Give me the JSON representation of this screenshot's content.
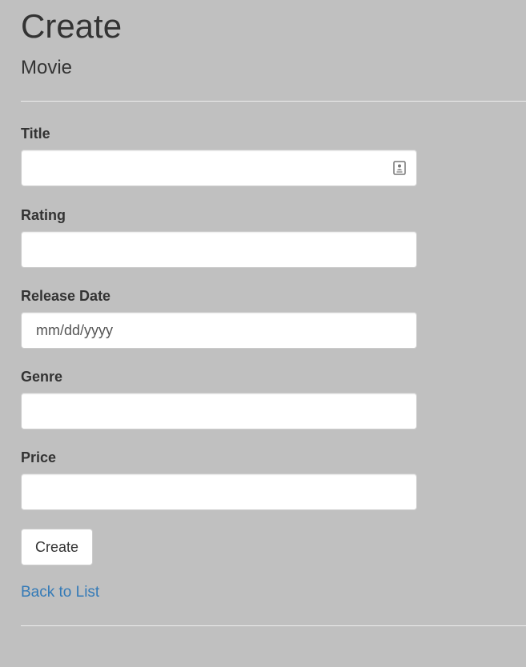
{
  "page": {
    "heading": "Create",
    "subheading": "Movie"
  },
  "form": {
    "fields": [
      {
        "label": "Title",
        "value": "",
        "placeholder": ""
      },
      {
        "label": "Rating",
        "value": "",
        "placeholder": ""
      },
      {
        "label": "Release Date",
        "value": "",
        "placeholder": "mm/dd/yyyy"
      },
      {
        "label": "Genre",
        "value": "",
        "placeholder": ""
      },
      {
        "label": "Price",
        "value": "",
        "placeholder": ""
      }
    ],
    "submit_label": "Create"
  },
  "nav": {
    "back_link": "Back to List"
  },
  "icons": {
    "title_field_icon": "contact-card-icon"
  },
  "colors": {
    "background": "#c0c0c0",
    "text": "#333333",
    "link": "#337ab7",
    "input_background": "#ffffff",
    "input_border": "#cccccc"
  }
}
